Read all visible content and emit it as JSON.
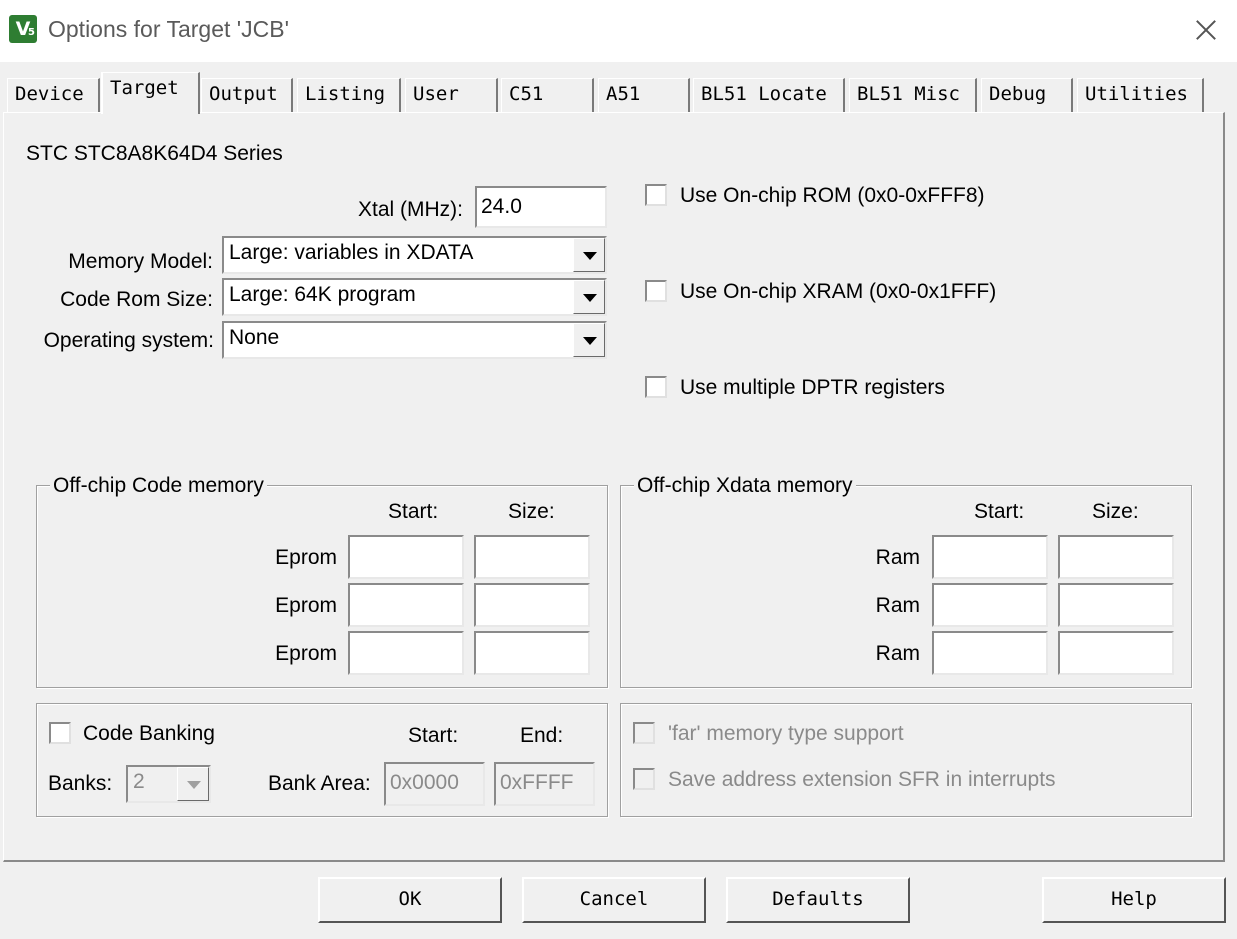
{
  "window": {
    "title": "Options for Target 'JCB'",
    "icon": "keil-uvision-icon"
  },
  "tabs": [
    {
      "label": "Device"
    },
    {
      "label": "Target",
      "active": true
    },
    {
      "label": "Output"
    },
    {
      "label": "Listing"
    },
    {
      "label": "User"
    },
    {
      "label": "C51"
    },
    {
      "label": "A51"
    },
    {
      "label": "BL51 Locate"
    },
    {
      "label": "BL51 Misc"
    },
    {
      "label": "Debug"
    },
    {
      "label": "Utilities"
    }
  ],
  "target": {
    "device_name": "STC STC8A8K64D4 Series",
    "xtal_label": "Xtal (MHz):",
    "xtal_value": "24.0",
    "memory_model_label": "Memory Model:",
    "memory_model_value": "Large: variables in XDATA",
    "code_rom_label": "Code Rom Size:",
    "code_rom_value": "Large: 64K program",
    "os_label": "Operating system:",
    "os_value": "None",
    "onchip_rom_label": "Use On-chip ROM (0x0-0xFFF8)",
    "onchip_xram_label": "Use On-chip XRAM (0x0-0x1FFF)",
    "multi_dptr_label": "Use multiple DPTR registers"
  },
  "code_memory": {
    "legend": "Off-chip Code memory",
    "start_header": "Start:",
    "size_header": "Size:",
    "rows": [
      {
        "label": "Eprom"
      },
      {
        "label": "Eprom"
      },
      {
        "label": "Eprom"
      }
    ]
  },
  "xdata_memory": {
    "legend": "Off-chip Xdata memory",
    "start_header": "Start:",
    "size_header": "Size:",
    "rows": [
      {
        "label": "Ram"
      },
      {
        "label": "Ram"
      },
      {
        "label": "Ram"
      }
    ]
  },
  "banking": {
    "code_banking_label": "Code Banking",
    "start_header": "Start:",
    "end_header": "End:",
    "banks_label": "Banks:",
    "banks_value": "2",
    "bank_area_label": "Bank Area:",
    "bank_start": "0x0000",
    "bank_end": "0xFFFF"
  },
  "extras": {
    "far_memory_label": "'far' memory type support",
    "save_sfr_label": "Save address extension SFR in interrupts"
  },
  "buttons": {
    "ok": "OK",
    "cancel": "Cancel",
    "defaults": "Defaults",
    "help": "Help"
  }
}
